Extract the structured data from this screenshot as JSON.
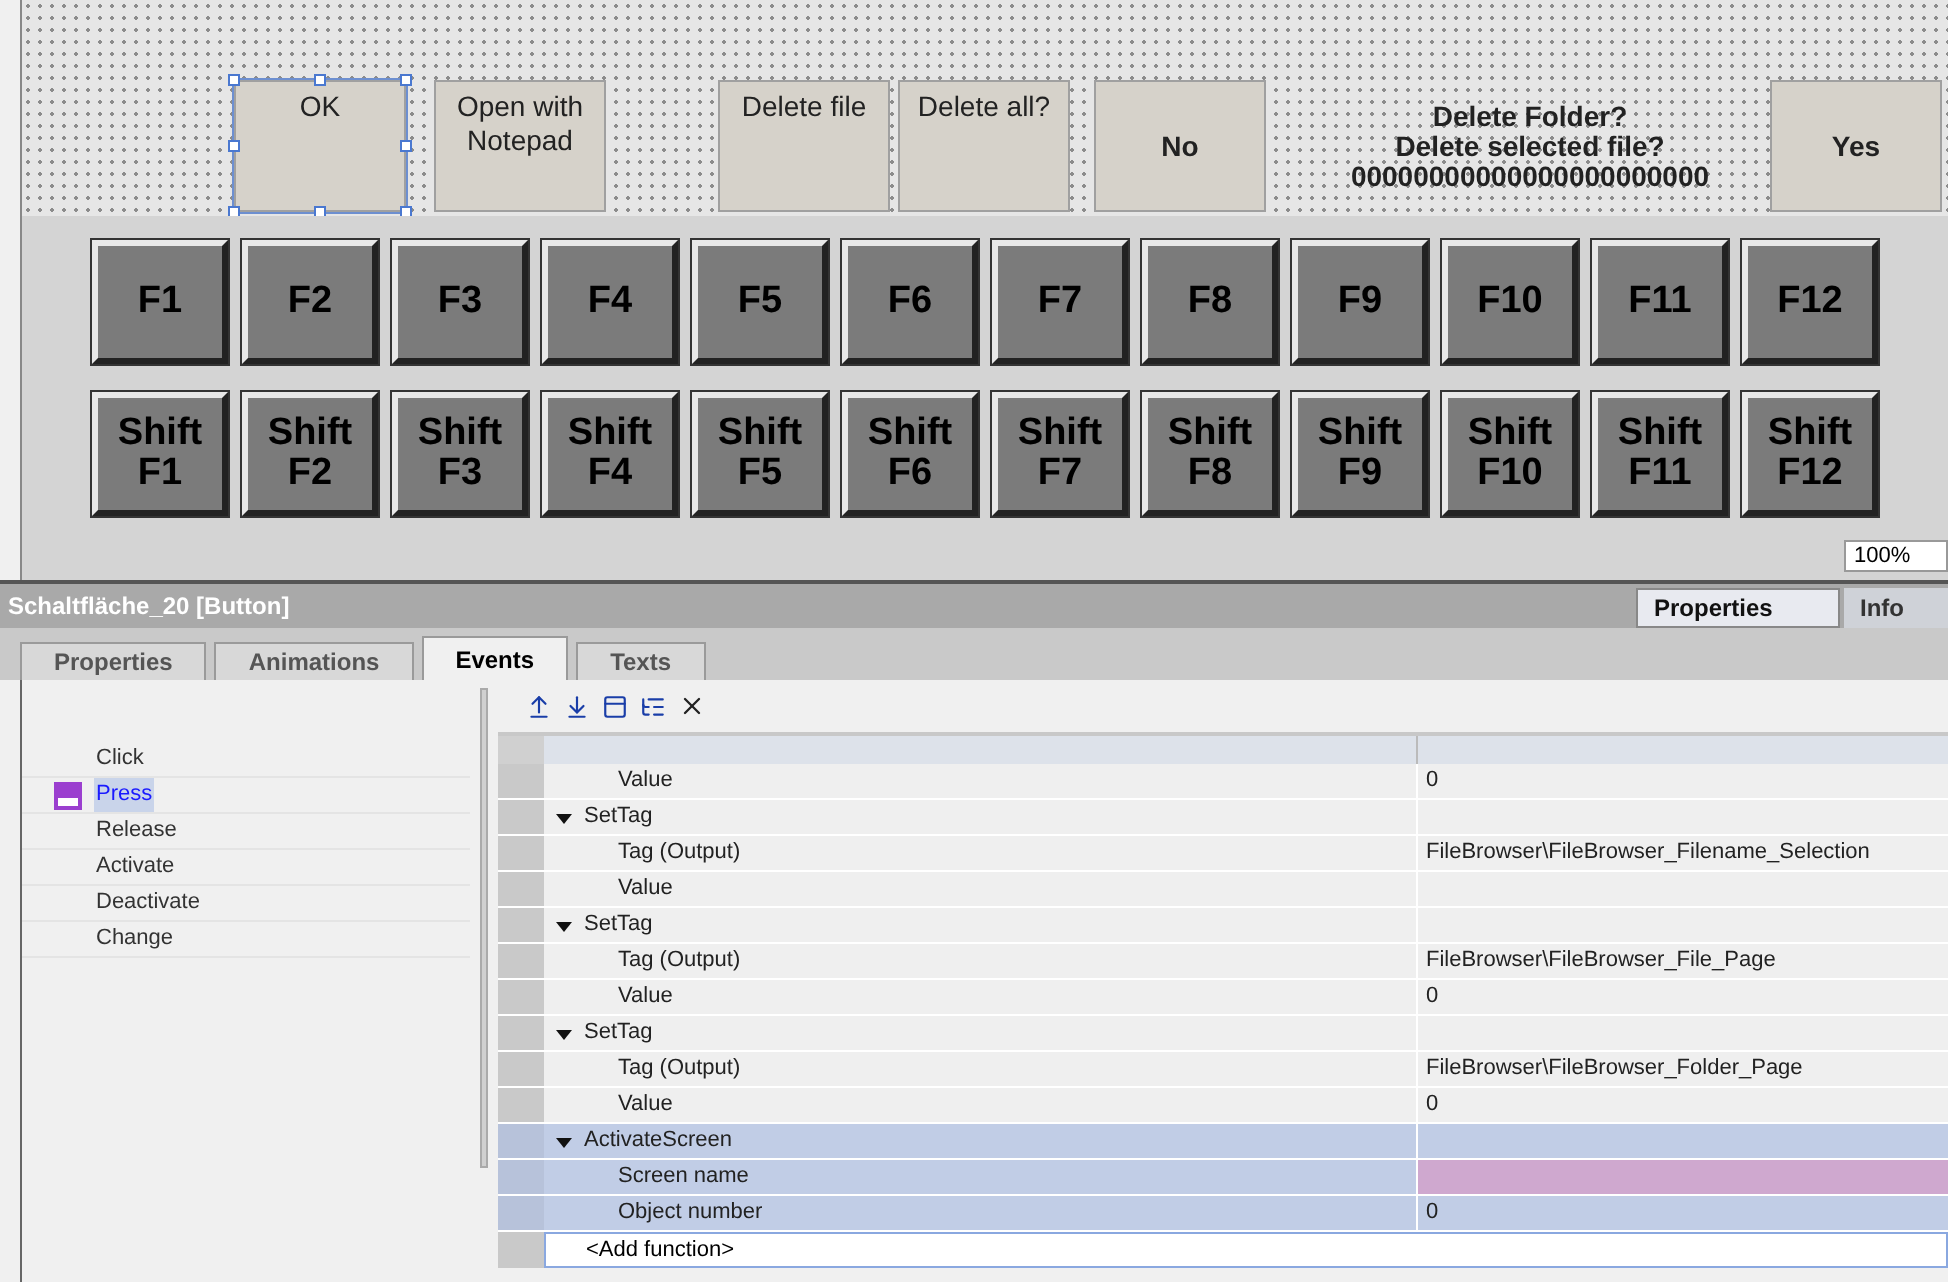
{
  "canvas": {
    "buttons": [
      {
        "label": "OK",
        "kind": "plain",
        "selected": true
      },
      {
        "label": "Open with Notepad",
        "kind": "plain",
        "selected": false
      },
      {
        "label": "Delete file",
        "kind": "plain",
        "selected": false
      },
      {
        "label": "Delete all?",
        "kind": "plain",
        "selected": false
      },
      {
        "label": "No",
        "kind": "bold",
        "selected": false
      }
    ],
    "dialog_text": {
      "title": "Delete Folder?",
      "message": "Delete selected file?",
      "number": "00000000000000000000000"
    },
    "confirm_button": {
      "label": "Yes",
      "kind": "bold",
      "selected": false
    }
  },
  "function_keys": [
    [
      "F1",
      "F2",
      "F3",
      "F4",
      "F5",
      "F6",
      "F7",
      "F8",
      "F9",
      "F10",
      "F11",
      "F12"
    ],
    [
      "Shift F1",
      "Shift F2",
      "Shift F3",
      "Shift F4",
      "Shift F5",
      "Shift F6",
      "Shift F7",
      "Shift F8",
      "Shift F9",
      "Shift F10",
      "Shift F11",
      "Shift F12"
    ]
  ],
  "zoom": "100%",
  "inspector": {
    "title": "Schaltfläche_20 [Button]",
    "side_tabs": [
      {
        "label": "Properties",
        "selected": true
      },
      {
        "label": "Info",
        "selected": false
      }
    ],
    "tabs": [
      {
        "label": "Properties",
        "selected": false
      },
      {
        "label": "Animations",
        "selected": false
      },
      {
        "label": "Events",
        "selected": true
      },
      {
        "label": "Texts",
        "selected": false
      }
    ],
    "events": [
      {
        "label": "Click",
        "selected": false
      },
      {
        "label": "Press",
        "selected": true
      },
      {
        "label": "Release",
        "selected": false
      },
      {
        "label": "Activate",
        "selected": false
      },
      {
        "label": "Deactivate",
        "selected": false
      },
      {
        "label": "Change",
        "selected": false
      }
    ],
    "rows": [
      {
        "kind": "param",
        "name": "Value",
        "value": "0",
        "selected": false,
        "flagged": false
      },
      {
        "kind": "group",
        "name": "SetTag",
        "expanded": true,
        "selected": false,
        "flagged": false
      },
      {
        "kind": "param",
        "name": "Tag (Output)",
        "value": "FileBrowser\\FileBrowser_Filename_Selection",
        "selected": false,
        "flagged": false
      },
      {
        "kind": "param",
        "name": "Value",
        "selected": false,
        "flagged": false
      },
      {
        "kind": "group",
        "name": "SetTag",
        "expanded": true,
        "selected": false,
        "flagged": false
      },
      {
        "kind": "param",
        "name": "Tag (Output)",
        "value": "FileBrowser\\FileBrowser_File_Page",
        "selected": false,
        "flagged": false
      },
      {
        "kind": "param",
        "name": "Value",
        "value": "0",
        "selected": false,
        "flagged": false
      },
      {
        "kind": "group",
        "name": "SetTag",
        "expanded": true,
        "selected": false,
        "flagged": false
      },
      {
        "kind": "param",
        "name": "Tag (Output)",
        "value": "FileBrowser\\FileBrowser_Folder_Page",
        "selected": false,
        "flagged": false
      },
      {
        "kind": "param",
        "name": "Value",
        "value": "0",
        "selected": false,
        "flagged": false
      },
      {
        "kind": "group",
        "name": "ActivateScreen",
        "expanded": true,
        "selected": true,
        "flagged": false
      },
      {
        "kind": "param",
        "name": "Screen name",
        "selected": true,
        "flagged": true
      },
      {
        "kind": "param",
        "name": "Object number",
        "value": "0",
        "selected": true,
        "flagged": false
      },
      {
        "kind": "add",
        "name": "<Add function>"
      }
    ]
  }
}
